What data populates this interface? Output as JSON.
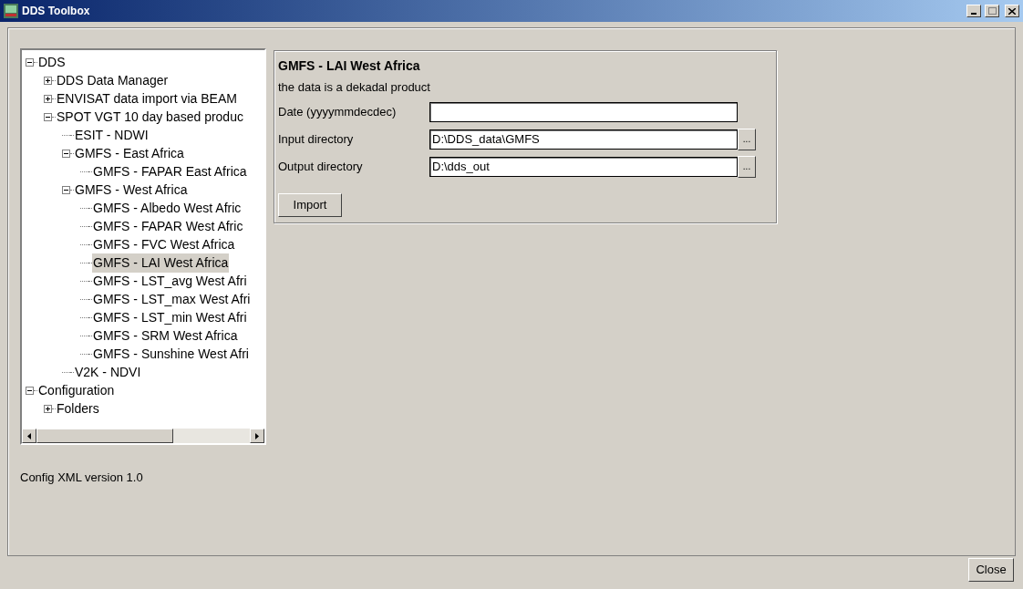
{
  "window": {
    "title": "DDS Toolbox"
  },
  "tree": [
    {
      "label": "DDS",
      "expanded": true,
      "selected": false,
      "children": [
        {
          "label": "DDS Data Manager",
          "expanded": false,
          "selected": false,
          "has_children": true
        },
        {
          "label": "ENVISAT data import via BEAM",
          "expanded": false,
          "selected": false,
          "has_children": true
        },
        {
          "label": "SPOT VGT 10 day based produc",
          "expanded": true,
          "selected": false,
          "children": [
            {
              "label": "ESIT - NDWI",
              "selected": false
            },
            {
              "label": "GMFS - East Africa",
              "expanded": true,
              "selected": false,
              "children": [
                {
                  "label": "GMFS - FAPAR East Africa",
                  "selected": false
                }
              ]
            },
            {
              "label": "GMFS - West Africa",
              "expanded": true,
              "selected": false,
              "children": [
                {
                  "label": "GMFS - Albedo West Afric",
                  "selected": false
                },
                {
                  "label": "GMFS - FAPAR West Afric",
                  "selected": false
                },
                {
                  "label": "GMFS - FVC West Africa",
                  "selected": false
                },
                {
                  "label": "GMFS - LAI West Africa",
                  "selected": true
                },
                {
                  "label": "GMFS - LST_avg West Afri",
                  "selected": false
                },
                {
                  "label": "GMFS - LST_max West Afri",
                  "selected": false
                },
                {
                  "label": "GMFS - LST_min West Afri",
                  "selected": false
                },
                {
                  "label": "GMFS - SRM West Africa",
                  "selected": false
                },
                {
                  "label": "GMFS - Sunshine West Afri",
                  "selected": false
                }
              ]
            },
            {
              "label": "V2K - NDVI",
              "selected": false
            }
          ]
        }
      ]
    },
    {
      "label": "Configuration",
      "expanded": true,
      "selected": false,
      "children": [
        {
          "label": "Folders",
          "expanded": false,
          "selected": false,
          "has_children": true
        }
      ]
    }
  ],
  "config_version": "Config XML version 1.0",
  "panel": {
    "title": "GMFS - LAI West Africa",
    "description": "the data is a dekadal product",
    "fields": [
      {
        "label": "Date (yyyymmdecdec)"
      },
      {
        "label": "Input directory",
        "value": "D:\\DDS_data\\GMFS",
        "browse": "..."
      },
      {
        "label": "Output directory",
        "value": "D:\\dds_out",
        "browse": "..."
      }
    ],
    "button": "Import"
  },
  "close_button": "Close"
}
